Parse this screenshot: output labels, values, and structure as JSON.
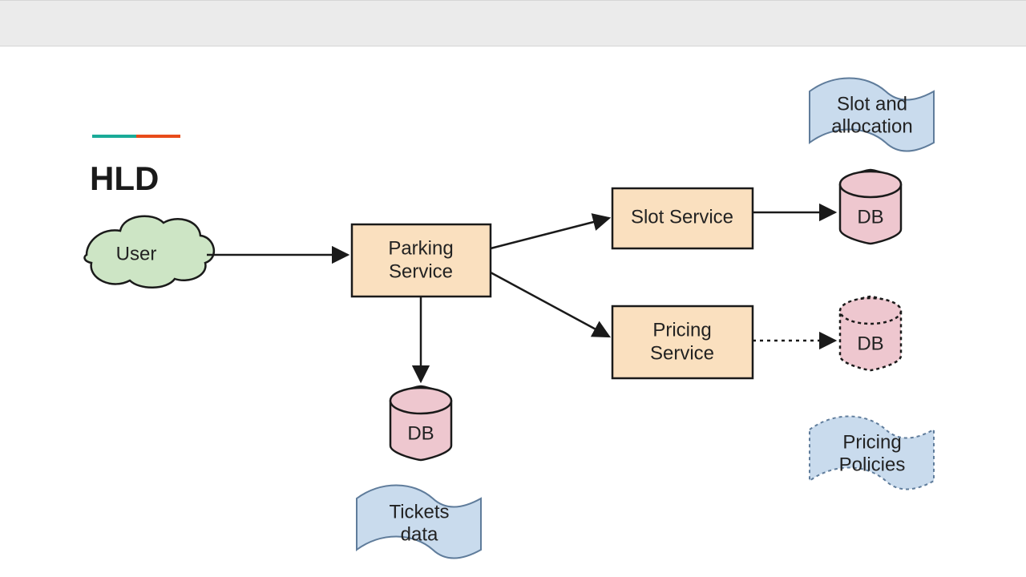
{
  "heading": "HLD",
  "nodes": {
    "user": "User",
    "parking_service_l1": "Parking",
    "parking_service_l2": "Service",
    "slot_service": "Slot Service",
    "pricing_service_l1": "Pricing",
    "pricing_service_l2": "Service",
    "db_center": "DB",
    "db_top_right": "DB",
    "db_right": "DB",
    "flag_tickets_l1": "Tickets",
    "flag_tickets_l2": "data",
    "flag_slot_l1": "Slot and",
    "flag_slot_l2": "allocation",
    "flag_pricing_l1": "Pricing",
    "flag_pricing_l2": "Policies"
  },
  "colors": {
    "teal": "#1aab98",
    "orange": "#e84c1a",
    "box_fill": "#fae0bf",
    "box_stroke": "#1a1a1a",
    "cloud_fill": "#cde5c5",
    "db_fill": "#eec7cf",
    "flag_fill": "#c9dbed",
    "flag_stroke": "#5f7c9b"
  }
}
